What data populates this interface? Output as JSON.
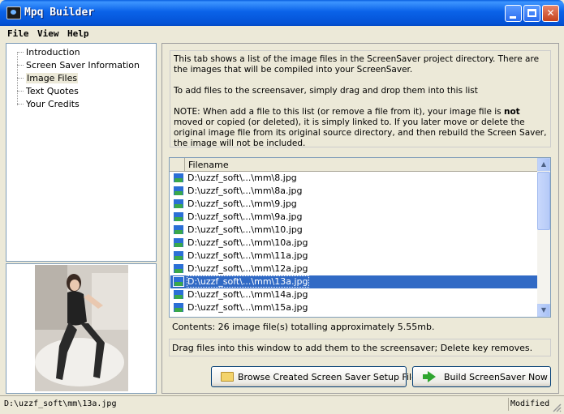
{
  "window": {
    "title": "Mpq Builder",
    "minimize_glyph": "",
    "close_glyph": "✕"
  },
  "menu": [
    {
      "label": "File"
    },
    {
      "label": "View"
    },
    {
      "label": "Help"
    }
  ],
  "tree": {
    "items": [
      {
        "label": "Introduction",
        "selected": false
      },
      {
        "label": "Screen Saver Information",
        "selected": false
      },
      {
        "label": "Image Files",
        "selected": true
      },
      {
        "label": "Text Quotes",
        "selected": false
      },
      {
        "label": "Your Credits",
        "selected": false
      }
    ]
  },
  "info": {
    "para1": "This tab shows a list of the image files in the ScreenSaver project directory. There are the images that will be compiled into your ScreenSaver.",
    "para2": "To add files to the screensaver, simply drag and drop them into this list",
    "para3_before": "NOTE: When add a file to this list (or remove a file from it), your image file is ",
    "para3_bold": "not",
    "para3_after": " moved or copied (or deleted), it is simply linked to. If you later move or delete the original image file from its original source directory, and then rebuild the Screen Saver, the image will not be included."
  },
  "file_list": {
    "column_header": "Filename",
    "rows": [
      {
        "name": "D:\\uzzf_soft\\...\\mm\\8.jpg",
        "selected": false
      },
      {
        "name": "D:\\uzzf_soft\\...\\mm\\8a.jpg",
        "selected": false
      },
      {
        "name": "D:\\uzzf_soft\\...\\mm\\9.jpg",
        "selected": false
      },
      {
        "name": "D:\\uzzf_soft\\...\\mm\\9a.jpg",
        "selected": false
      },
      {
        "name": "D:\\uzzf_soft\\...\\mm\\10.jpg",
        "selected": false
      },
      {
        "name": "D:\\uzzf_soft\\...\\mm\\10a.jpg",
        "selected": false
      },
      {
        "name": "D:\\uzzf_soft\\...\\mm\\11a.jpg",
        "selected": false
      },
      {
        "name": "D:\\uzzf_soft\\...\\mm\\12a.jpg",
        "selected": false
      },
      {
        "name": "D:\\uzzf_soft\\...\\mm\\13a.jpg",
        "selected": true
      },
      {
        "name": "D:\\uzzf_soft\\...\\mm\\14a.jpg",
        "selected": false
      },
      {
        "name": "D:\\uzzf_soft\\...\\mm\\15a.jpg",
        "selected": false
      }
    ]
  },
  "contents_summary": "Contents: 26 image file(s) totalling approximately 5.55mb.",
  "hint": "Drag files into this window to add them to the screensaver; Delete key removes.",
  "buttons": {
    "browse_label": "Browse Created Screen Saver Setup Files",
    "build_label": "Build ScreenSaver Now"
  },
  "statusbar": {
    "path": "D:\\uzzf_soft\\mm\\13a.jpg",
    "state": "Modified"
  },
  "colors": {
    "selection": "#316AC5",
    "titlebar": "#0A62E8",
    "window_bg": "#ECE9D8"
  },
  "icons": {
    "app": "app-icon",
    "row": "image-file-icon",
    "browse": "folder-icon",
    "build": "green-arrow-icon"
  }
}
